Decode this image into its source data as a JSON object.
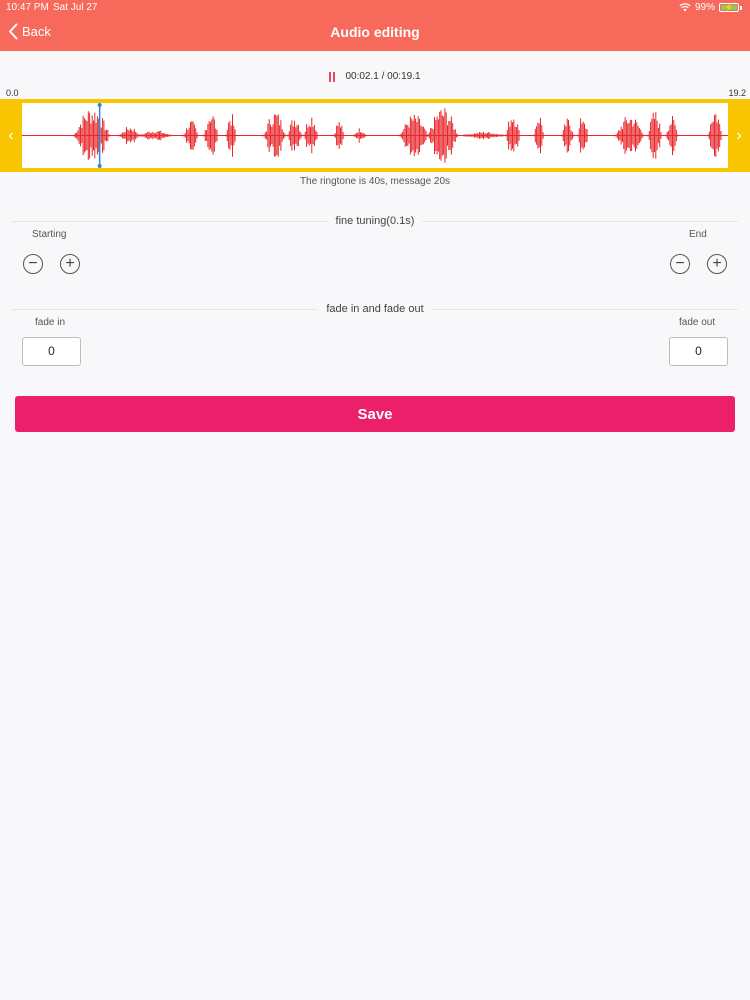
{
  "status_bar": {
    "time": "10:47 PM",
    "date": "Sat Jul 27",
    "battery": "99%"
  },
  "header": {
    "back_label": "Back",
    "title": "Audio editing"
  },
  "player": {
    "elapsed": "00:02.1",
    "separator": " / ",
    "total": "00:19.1",
    "range_start": "0.0",
    "range_end": "19.2"
  },
  "waveform": {
    "info": "The ringtone is 40s, message 20s",
    "playhead_fraction": 0.11
  },
  "fine_tuning": {
    "title": "fine tuning(0.1s)",
    "start_label": "Starting",
    "end_label": "End"
  },
  "fade": {
    "title": "fade in and fade out",
    "fade_in_label": "fade in",
    "fade_out_label": "fade out",
    "fade_in_value": "0",
    "fade_out_value": "0"
  },
  "save_label": "Save",
  "colors": {
    "header": "#f76a5b",
    "wave": "#e8262a",
    "frame": "#f9c400",
    "save": "#ec1f6a",
    "playhead": "#2a88d8"
  },
  "icons": [
    "chevron-left-icon",
    "pause-icon",
    "wifi-icon",
    "battery-icon",
    "minus-icon",
    "plus-icon"
  ]
}
